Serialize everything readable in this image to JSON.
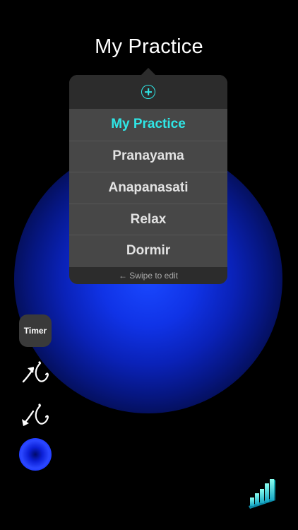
{
  "header": {
    "title": "My Practice"
  },
  "popover": {
    "add_icon": "plus-circle-icon",
    "items": [
      {
        "label": "My Practice",
        "selected": true
      },
      {
        "label": "Pranayama",
        "selected": false
      },
      {
        "label": "Anapanasati",
        "selected": false
      },
      {
        "label": "Relax",
        "selected": false
      },
      {
        "label": "Dormir",
        "selected": false
      }
    ],
    "footer_hint": "← Swipe to edit"
  },
  "toolbar": {
    "timer_label": "Timer",
    "inhale_icon": "inhale-arrow-icon",
    "exhale_icon": "exhale-arrow-icon",
    "orb_icon": "breathing-orb-icon",
    "palette_icon": "color-palette-icon",
    "stats_icon": "statistics-icon"
  },
  "colors": {
    "accent": "#2fe6e6",
    "background": "#000000",
    "glow": "#1a48ff",
    "popover_body": "#474747",
    "popover_header": "#2c2c2c"
  },
  "palette_colors": [
    "#d9d9d9",
    "#8a8a8a",
    "#3f3f3f",
    "#3cb37a",
    "#a98aff",
    "#f6a23b",
    "#1a4cff",
    "#b4461a",
    "#264a5a"
  ]
}
